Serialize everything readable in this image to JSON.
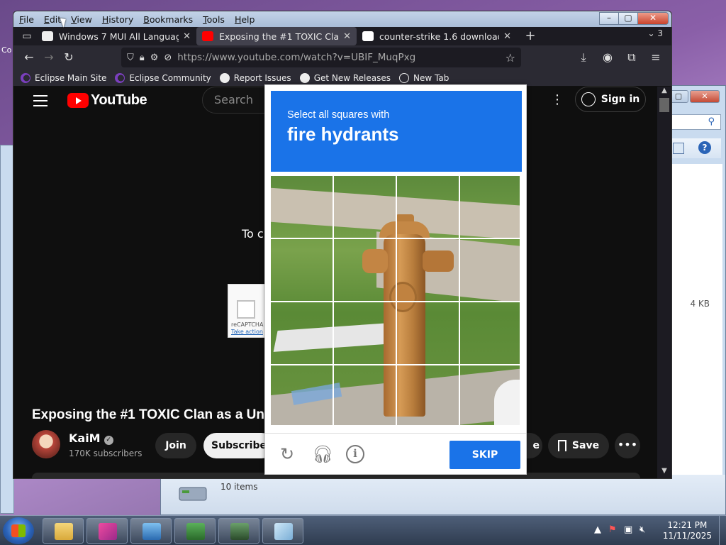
{
  "bg_window": {
    "items_count": "10 items",
    "file_size": "4 KB",
    "help_icon": "help-icon"
  },
  "desktop": {
    "left_label": "Co"
  },
  "menubar": {
    "items": [
      "File",
      "Edit",
      "View",
      "History",
      "Bookmarks",
      "Tools",
      "Help"
    ]
  },
  "tabs": [
    {
      "title": "Windows 7 MUI All Language Pa",
      "favicon": "document-icon",
      "active": false
    },
    {
      "title": "Exposing the #1 TOXIC Clan as a",
      "favicon": "youtube-icon",
      "active": true
    },
    {
      "title": "counter-strike 1.6 download - Fr",
      "favicon": "cs-icon",
      "active": false
    }
  ],
  "tab_count": "3",
  "navbar": {
    "url": "https://www.youtube.com/watch?v=UBIF_MuqPxg"
  },
  "bookmarks": [
    "Eclipse Main Site",
    "Eclipse Community",
    "Report Issues",
    "Get New Releases",
    "New Tab"
  ],
  "youtube": {
    "logo_text": "YouTube",
    "search_placeholder": "Search",
    "signin_label": "Sign in",
    "video_message": "To c",
    "mini_recaptcha": {
      "label": "reCAPTCHA",
      "link": "Take action"
    },
    "video_title": "Exposing the #1 TOXIC Clan as a Unc",
    "channel_name": "KaiM",
    "subscribers": "170K subscribers",
    "join_label": "Join",
    "subscribe_label": "Subscribe",
    "share_label": "e",
    "save_label": "Save",
    "more_label": "•••"
  },
  "captcha": {
    "instruction_line1": "Select all squares with",
    "instruction_line2": "fire hydrants",
    "skip_label": "SKIP",
    "colors": {
      "header": "#1a73e8",
      "button": "#1a73e8"
    }
  },
  "taskbar": {
    "time": "12:21 PM",
    "date": "11/11/2025"
  }
}
